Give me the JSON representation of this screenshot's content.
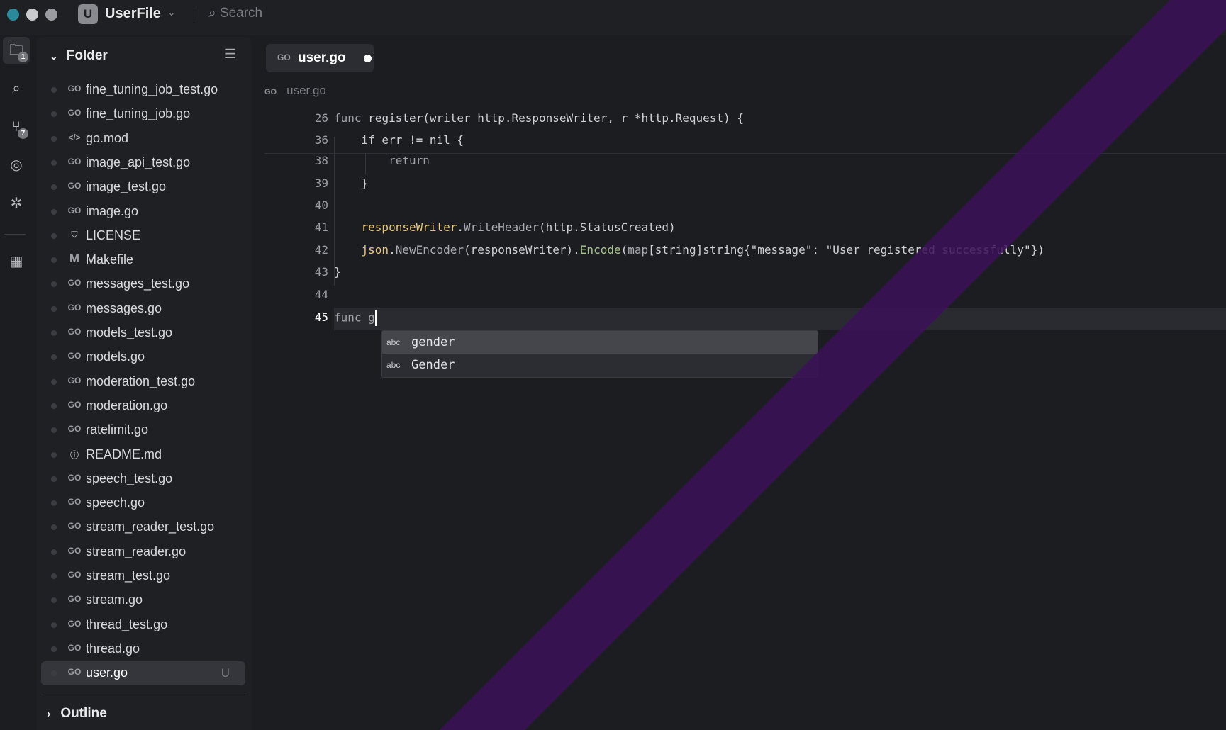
{
  "titlebar": {
    "project_initial": "U",
    "project_name": "UserFile",
    "search_placeholder": "Search"
  },
  "activity": {
    "explorer_badge": "1",
    "scm_badge": "7"
  },
  "sidebar": {
    "title": "Folder",
    "files": [
      {
        "name": "fine_tuning_job_test.go",
        "icon": "go"
      },
      {
        "name": "fine_tuning_job.go",
        "icon": "go"
      },
      {
        "name": "go.mod",
        "icon": "code"
      },
      {
        "name": "image_api_test.go",
        "icon": "go"
      },
      {
        "name": "image_test.go",
        "icon": "go"
      },
      {
        "name": "image.go",
        "icon": "go"
      },
      {
        "name": "LICENSE",
        "icon": "shield"
      },
      {
        "name": "Makefile",
        "icon": "M"
      },
      {
        "name": "messages_test.go",
        "icon": "go"
      },
      {
        "name": "messages.go",
        "icon": "go"
      },
      {
        "name": "models_test.go",
        "icon": "go"
      },
      {
        "name": "models.go",
        "icon": "go"
      },
      {
        "name": "moderation_test.go",
        "icon": "go"
      },
      {
        "name": "moderation.go",
        "icon": "go"
      },
      {
        "name": "ratelimit.go",
        "icon": "go"
      },
      {
        "name": "README.md",
        "icon": "info"
      },
      {
        "name": "speech_test.go",
        "icon": "go"
      },
      {
        "name": "speech.go",
        "icon": "go"
      },
      {
        "name": "stream_reader_test.go",
        "icon": "go"
      },
      {
        "name": "stream_reader.go",
        "icon": "go"
      },
      {
        "name": "stream_test.go",
        "icon": "go"
      },
      {
        "name": "stream.go",
        "icon": "go"
      },
      {
        "name": "thread_test.go",
        "icon": "go"
      },
      {
        "name": "thread.go",
        "icon": "go"
      },
      {
        "name": "user.go",
        "icon": "go",
        "status": "U",
        "selected": true
      }
    ],
    "outline": "Outline"
  },
  "editor": {
    "tab": {
      "label": "user.go",
      "icon": "GO"
    },
    "breadcrumb": "user.go",
    "lines": [
      {
        "n": "26",
        "tokens": [
          [
            "func ",
            "k"
          ],
          [
            "register",
            "f"
          ],
          [
            "(writer http.ResponseWriter, r *http.Request) {",
            "s"
          ]
        ]
      },
      {
        "n": "36",
        "tokens": [
          [
            "    if err != nil {",
            "s"
          ]
        ]
      },
      {
        "n": "38",
        "tokens": [
          [
            "        return",
            "k"
          ]
        ]
      },
      {
        "n": "39",
        "tokens": [
          [
            "    }",
            "s"
          ]
        ]
      },
      {
        "n": "40",
        "tokens": []
      },
      {
        "n": "41",
        "tokens": [
          [
            "    ",
            "s"
          ],
          [
            "responseWriter",
            "y"
          ],
          [
            ".",
            "s"
          ],
          [
            "WriteHeader",
            "m"
          ],
          [
            "(http.StatusCreated)",
            "s"
          ]
        ]
      },
      {
        "n": "42",
        "tokens": [
          [
            "    ",
            "s"
          ],
          [
            "json",
            "y"
          ],
          [
            ".",
            "s"
          ],
          [
            "NewEncoder",
            "m"
          ],
          [
            "(responseWriter).",
            "s"
          ],
          [
            "Encode",
            "g"
          ],
          [
            "(",
            "s"
          ],
          [
            "map",
            "m"
          ],
          [
            "[string]string{\"message\": \"User registered successfully\"})",
            "s"
          ]
        ]
      },
      {
        "n": "43",
        "tokens": [
          [
            "}",
            "s"
          ]
        ]
      },
      {
        "n": "44",
        "tokens": []
      },
      {
        "n": "45",
        "tokens": [
          [
            "func g",
            "k"
          ]
        ],
        "current": true
      }
    ],
    "autocomplete": [
      {
        "kind": "abc",
        "label": "gender"
      },
      {
        "kind": "abc",
        "label": "Gender"
      }
    ]
  },
  "colors": {
    "accent_stripe": "#3b1258",
    "bg": "#1c1d21"
  }
}
